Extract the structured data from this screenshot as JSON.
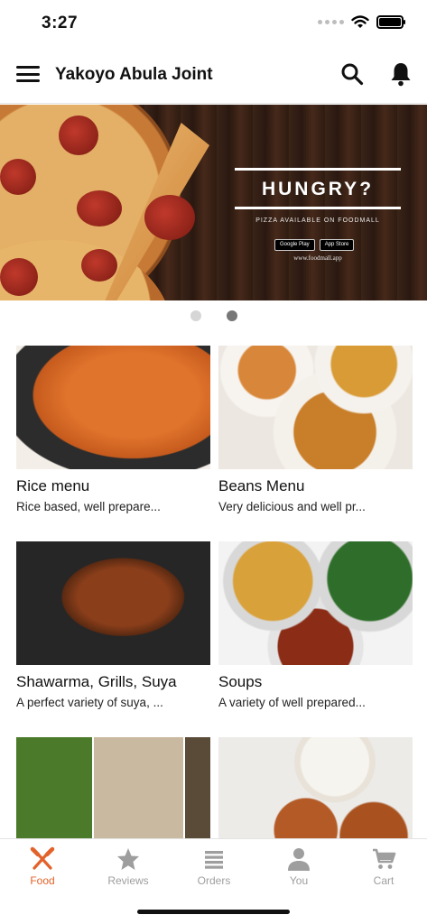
{
  "status_bar": {
    "time": "3:27"
  },
  "header": {
    "title": "Yakoyo Abula Joint"
  },
  "banner": {
    "headline": "HUNGRY?",
    "subtitle": "PIZZA AVAILABLE ON FOODMALL",
    "store_google": "Google Play",
    "store_apple": "App Store",
    "url": "www.foodmall.app",
    "slide_count": 2,
    "active_slide": 2
  },
  "menus": [
    {
      "name": "Rice menu",
      "description": "Rice based, well prepare..."
    },
    {
      "name": "Beans Menu",
      "description": "Very delicious and well pr..."
    },
    {
      "name": "Shawarma, Grills, Suya",
      "description": "A perfect variety of suya, ..."
    },
    {
      "name": "Soups",
      "description": "A variety of well prepared..."
    },
    {
      "name": "",
      "description": ""
    },
    {
      "name": "",
      "description": ""
    }
  ],
  "tabs": [
    {
      "label": "Food",
      "icon": "fork-knife-icon",
      "active": true
    },
    {
      "label": "Reviews",
      "icon": "star-icon",
      "active": false
    },
    {
      "label": "Orders",
      "icon": "list-icon",
      "active": false
    },
    {
      "label": "You",
      "icon": "person-icon",
      "active": false
    },
    {
      "label": "Cart",
      "icon": "cart-icon",
      "active": false
    }
  ],
  "colors": {
    "accent": "#e2622a",
    "inactive_tab": "#9e9e9e"
  }
}
